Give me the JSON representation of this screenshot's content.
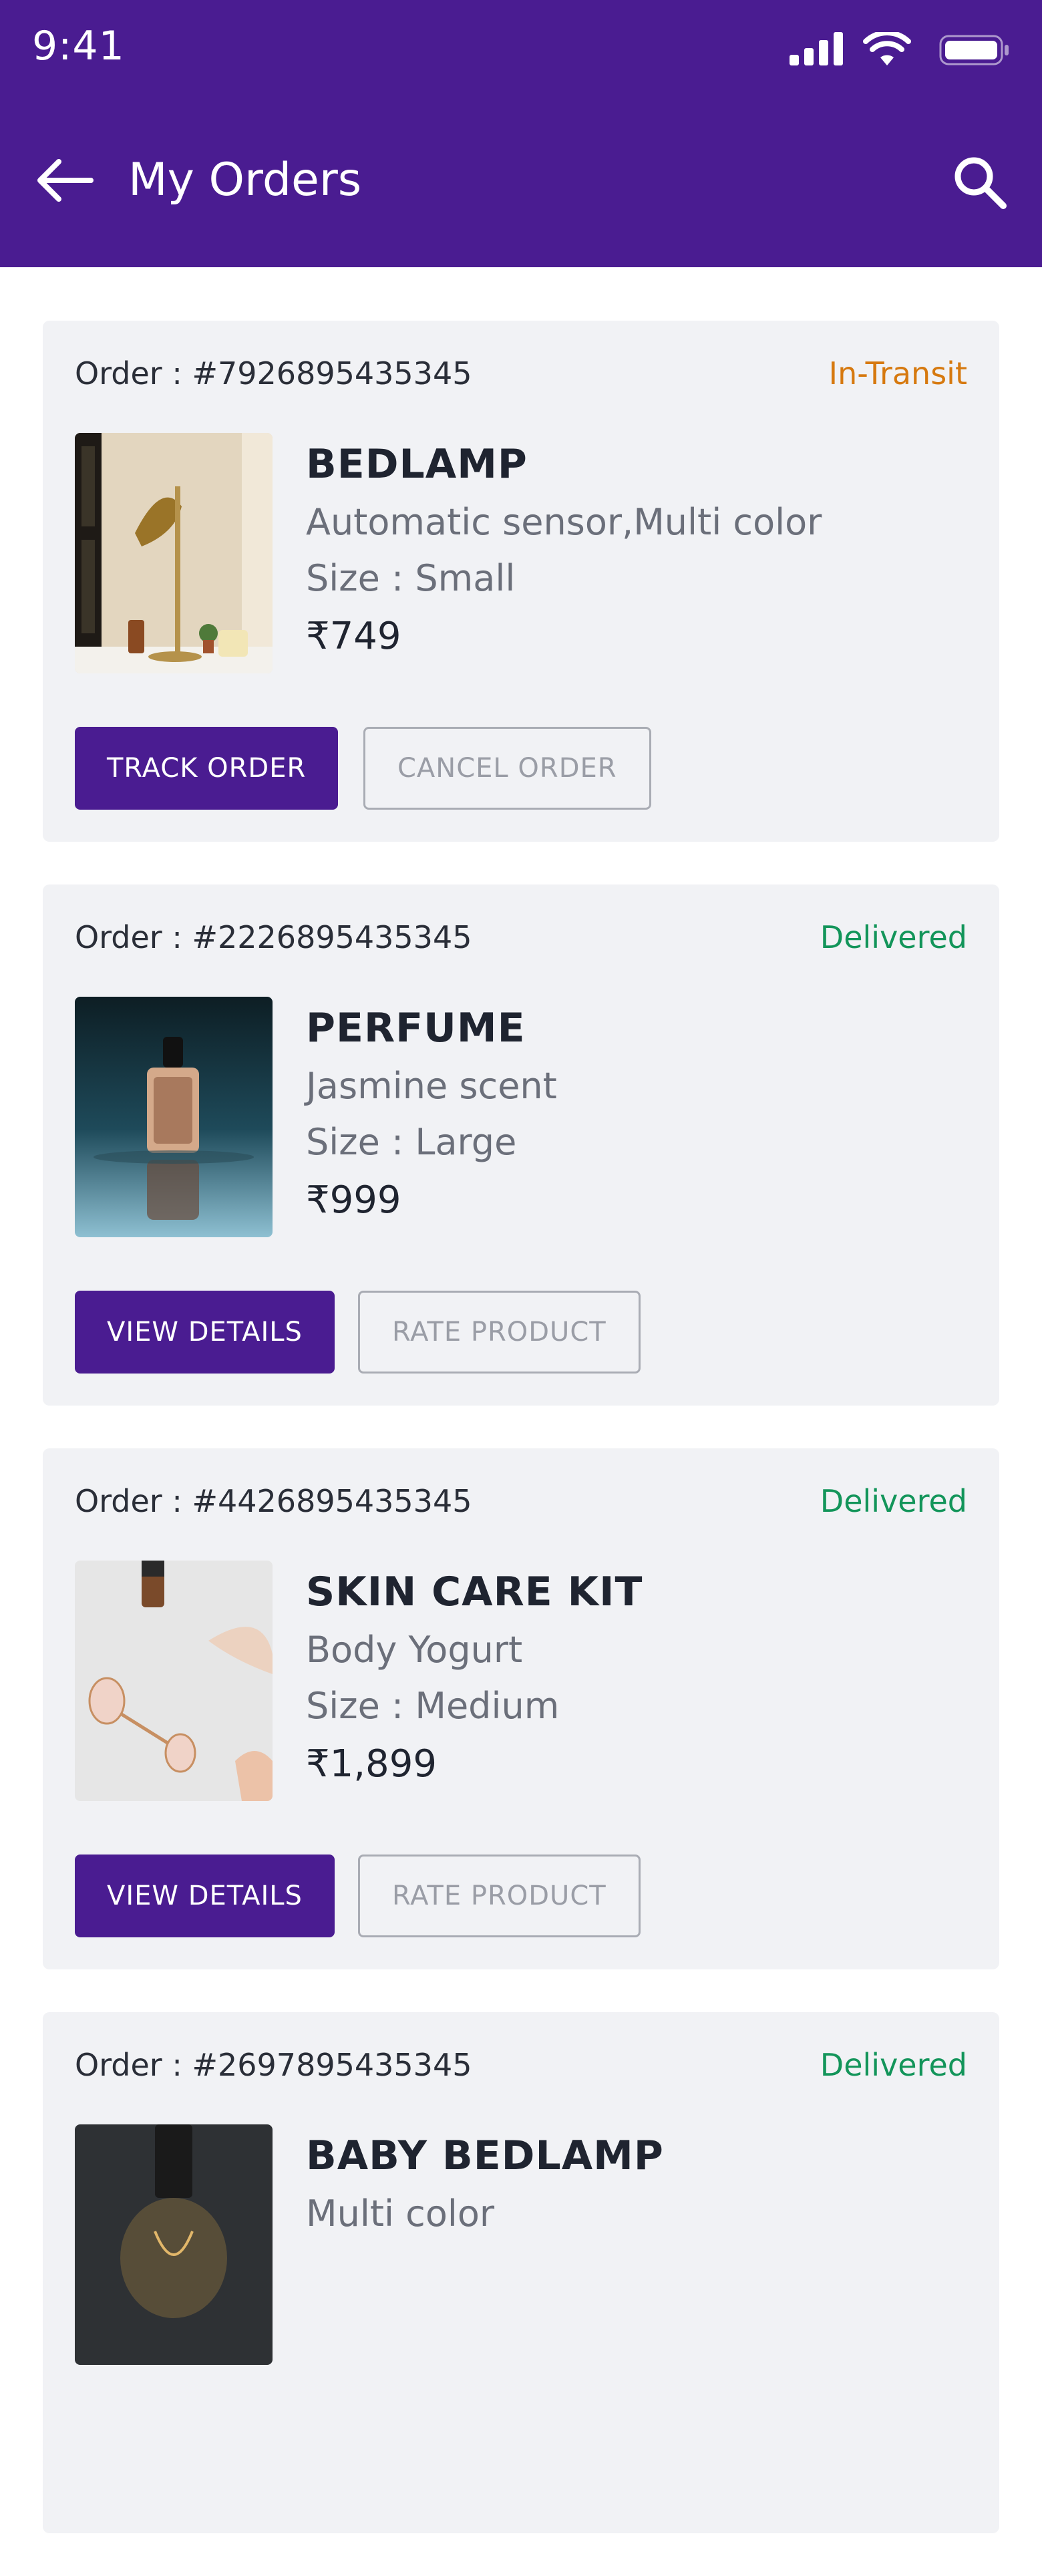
{
  "status_bar": {
    "time": "9:41"
  },
  "header": {
    "title": "My Orders",
    "back_icon": "arrow-left-icon",
    "search_icon": "search-icon"
  },
  "colors": {
    "brand": "#4a1c91",
    "in_transit": "#d6790f",
    "delivered": "#13955a"
  },
  "orders": [
    {
      "order_label": "Order : #7926895435345",
      "status": "In-Transit",
      "status_color": "#d6790f",
      "name": "BEDLAMP",
      "description": "Automatic sensor,Multi color",
      "size": "Size : Small",
      "price": "₹749",
      "primary_action": "TRACK ORDER",
      "secondary_action": "CANCEL ORDER"
    },
    {
      "order_label": "Order : #2226895435345",
      "status": "Delivered",
      "status_color": "#13955a",
      "name": "PERFUME",
      "description": "Jasmine scent",
      "size": "Size : Large",
      "price": "₹999",
      "primary_action": "VIEW DETAILS",
      "secondary_action": "RATE PRODUCT"
    },
    {
      "order_label": "Order : #4426895435345",
      "status": "Delivered",
      "status_color": "#13955a",
      "name": "SKIN CARE KIT",
      "description": "Body Yogurt",
      "size": "Size : Medium",
      "price": "₹1,899",
      "primary_action": "VIEW DETAILS",
      "secondary_action": "RATE PRODUCT"
    },
    {
      "order_label": "Order : #2697895435345",
      "status": "Delivered",
      "status_color": "#13955a",
      "name": "BABY BEDLAMP",
      "description": "Multi color"
    }
  ]
}
